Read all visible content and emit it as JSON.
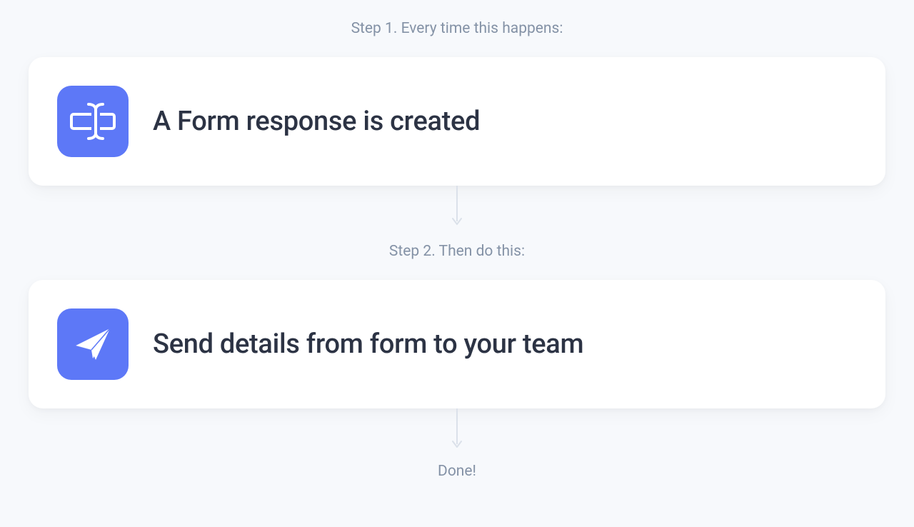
{
  "step1": {
    "label": "Step 1. Every time this happens:",
    "title": "A Form response is created"
  },
  "step2": {
    "label": "Step 2. Then do this:",
    "title": "Send details from form to your team"
  },
  "done": {
    "label": "Done!"
  },
  "colors": {
    "accent": "#5d78f7",
    "background": "#f7f9fc",
    "cardBackground": "#ffffff",
    "titleText": "#2c3344",
    "mutedText": "#8492a6",
    "connectorLine": "#dbe1ea"
  }
}
